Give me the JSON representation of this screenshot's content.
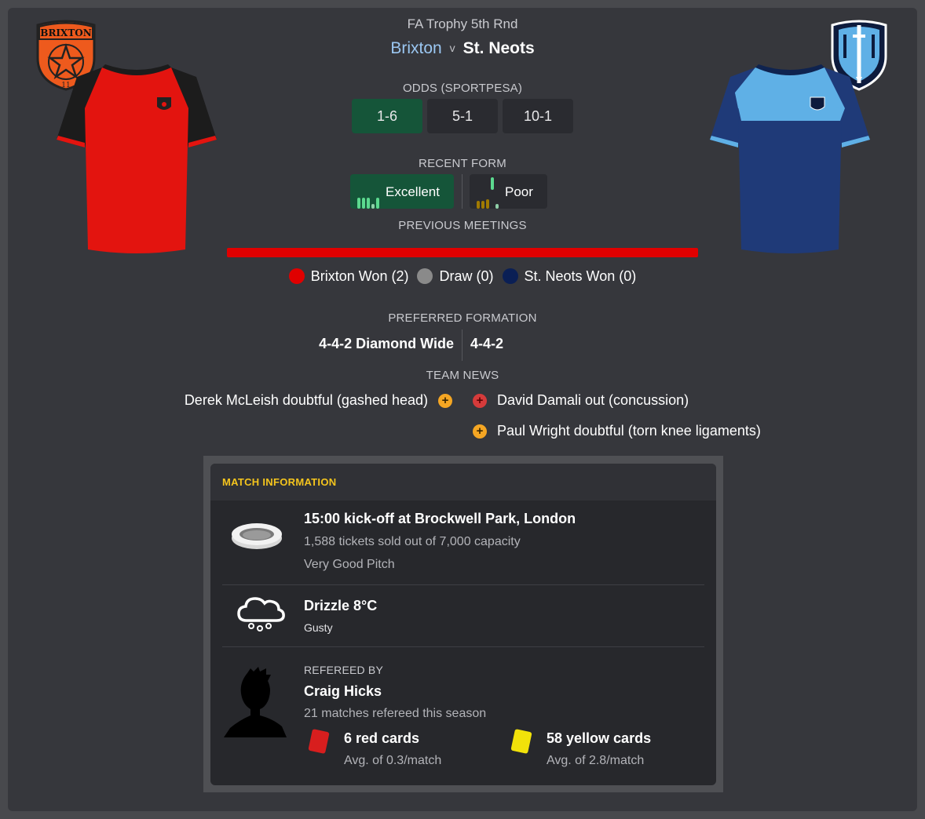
{
  "match": {
    "competition": "FA Trophy 5th Rnd",
    "home_team": "Brixton",
    "versus": "v",
    "away_team": "St. Neots"
  },
  "odds": {
    "caption": "ODDS (SPORTPESA)",
    "home": "1-6",
    "draw": "5-1",
    "away": "10-1"
  },
  "recent_form": {
    "caption": "RECENT FORM",
    "home": "Excellent",
    "away": "Poor"
  },
  "previous_meetings": {
    "caption": "PREVIOUS MEETINGS",
    "home_won": "Brixton Won (2)",
    "draw": "Draw (0)",
    "away_won": "St. Neots Won (0)",
    "home_share": 1.0
  },
  "preferred_formation": {
    "caption": "PREFERRED FORMATION",
    "home": "4-4-2 Diamond Wide",
    "away": "4-4-2"
  },
  "team_news": {
    "caption": "TEAM NEWS",
    "home": [
      "Derek McLeish doubtful (gashed head)"
    ],
    "away": [
      "David Damali out (concussion)",
      "Paul Wright doubtful (torn knee ligaments)"
    ]
  },
  "match_information": {
    "title": "MATCH INFORMATION",
    "venue": {
      "kickoff": "15:00 kick-off at Brockwell Park, London",
      "tickets": "1,588 tickets sold out of 7,000 capacity",
      "pitch": "Very Good Pitch"
    },
    "weather": {
      "summary": "Drizzle 8°C",
      "wind": "Gusty"
    },
    "referee": {
      "caption": "REFEREED BY",
      "name": "Craig Hicks",
      "matches": "21 matches refereed this season",
      "red_cards": "6 red cards",
      "red_avg": "Avg. of 0.3/match",
      "yellow_cards": "58 yellow cards",
      "yellow_avg": "Avg. of 2.8/match"
    }
  },
  "badges": {
    "home_badge_text": "BRIXTON",
    "home_badge_sub": "11"
  },
  "colors": {
    "home_primary": "#e3140f",
    "home_sleeves": "#1b1b1b",
    "away_primary": "#1f3a78",
    "away_top": "#5fb0e6",
    "favourite": "#155539",
    "accent_yellow": "#f5c51d"
  }
}
